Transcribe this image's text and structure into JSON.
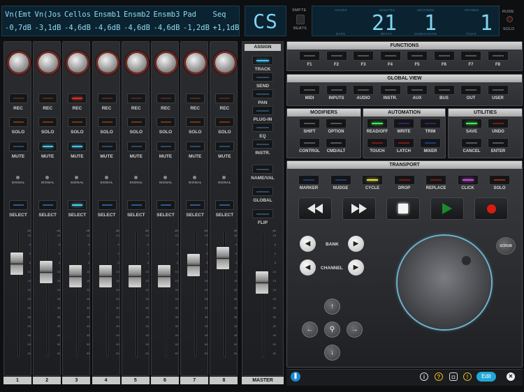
{
  "lcd": {
    "names": [
      "Vn(Emt",
      "Vn(Jos",
      "Cellos",
      "Ensmb1",
      "Ensmb2",
      "Ensmb3",
      "Pad",
      "Seq"
    ],
    "levels": [
      "-0,7dB",
      "-3,1dB",
      "-4,6dB",
      "-4,6dB",
      "-4,6dB",
      "-4,6dB",
      "-1,2dB",
      "+1,1dB"
    ]
  },
  "mode_display": "CS",
  "smpte_label": "SMPTE",
  "beats_label": "BEATS",
  "timecode": {
    "hours_label": "HOURS",
    "minutes_label": "MINUTES",
    "seconds_label": "SECONDS",
    "frames_label": "FRAMES",
    "bars_label": "BARS",
    "beats_label": "BEATS",
    "subdivision_label": "SUBDIVISION",
    "ticks_label": "TICKS",
    "bars": "21",
    "beats": "1",
    "ticks": "1"
  },
  "rude_label": "RUDE",
  "rude_solo_label": "SOLO",
  "strip_labels": {
    "rec": "REC",
    "solo": "SOLO",
    "mute": "MUTE",
    "signal": "SIGNAL",
    "select": "SELECT"
  },
  "fader_scale": [
    "10",
    "5",
    "0",
    "5",
    "10",
    "15",
    "20",
    "25",
    "30",
    "35",
    "40",
    "45",
    "50",
    "60"
  ],
  "fader_scale_top": "dB",
  "channels": [
    "1",
    "2",
    "3",
    "4",
    "5",
    "6",
    "7",
    "8"
  ],
  "master_label": "MASTER",
  "assign": {
    "title": "ASSIGN",
    "items": [
      "TRACK",
      "SEND",
      "PAN",
      "PLUG-IN",
      "EQ",
      "INSTR.",
      "NAME/VAL",
      "GLOBAL",
      "FLIP"
    ]
  },
  "functions": {
    "title": "FUNCTIONS",
    "items": [
      "F1",
      "F2",
      "F3",
      "F4",
      "F5",
      "F6",
      "F7",
      "F8"
    ]
  },
  "global_view": {
    "title": "GLOBAL VIEW",
    "items": [
      "MIDI",
      "INPUTS",
      "AUDIO",
      "INSTR.",
      "AUX",
      "BUS",
      "OUT",
      "USER"
    ]
  },
  "modifiers": {
    "title": "MODIFIERS",
    "items": [
      "SHIFT",
      "OPTION",
      "CONTROL",
      "CMD/ALT"
    ]
  },
  "automation": {
    "title": "AUTOMATION",
    "items": [
      "READ/OFF",
      "WRITE",
      "TRIM",
      "TOUCH",
      "LATCH",
      "MIXER"
    ]
  },
  "utilities": {
    "title": "UTILITIES",
    "items": [
      "SAVE",
      "UNDO",
      "CANCEL",
      "ENTER"
    ]
  },
  "transport": {
    "title": "TRANSPORT",
    "items": [
      "MARKER",
      "NUDGE",
      "CYCLE",
      "DROP",
      "REPLACE",
      "CLICK",
      "SOLO"
    ],
    "bank_label": "BANK",
    "channel_label": "CHANNEL",
    "scrub_label": "SCRUB"
  },
  "bottom": {
    "edit_label": "Edit"
  }
}
